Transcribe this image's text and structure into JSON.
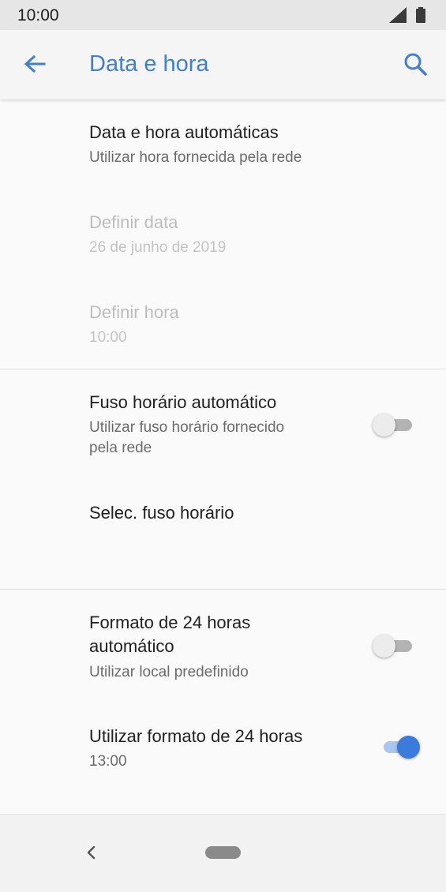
{
  "status_bar": {
    "time": "10:00"
  },
  "app_bar": {
    "title": "Data e hora"
  },
  "settings": {
    "auto_datetime": {
      "title": "Data e hora automáticas",
      "subtitle": "Utilizar hora fornecida pela rede"
    },
    "set_date": {
      "title": "Definir data",
      "subtitle": "26 de junho de 2019"
    },
    "set_time": {
      "title": "Definir hora",
      "subtitle": "10:00"
    },
    "auto_timezone": {
      "title": "Fuso horário automático",
      "subtitle_line1": "Utilizar fuso horário fornecido",
      "subtitle_line2": "pela rede",
      "toggle_on": false
    },
    "select_timezone": {
      "title": "Selec. fuso horário"
    },
    "auto_24h": {
      "title_line1": "Formato de 24 horas",
      "title_line2": "automático",
      "subtitle": "Utilizar local predefinido",
      "toggle_on": false
    },
    "use_24h": {
      "title": "Utilizar formato de 24 horas",
      "subtitle": "13:00",
      "toggle_on": true
    }
  },
  "colors": {
    "accent": "#3f7fd6",
    "toggle_on": "#3a7bdc",
    "toggle_off_track": "#b3b3b3"
  },
  "icons": {
    "back": "arrow-left-icon",
    "search": "search-icon",
    "signal": "cell-signal-icon",
    "battery": "battery-icon",
    "nav_back": "chevron-left-icon",
    "nav_home": "home-pill-icon"
  }
}
